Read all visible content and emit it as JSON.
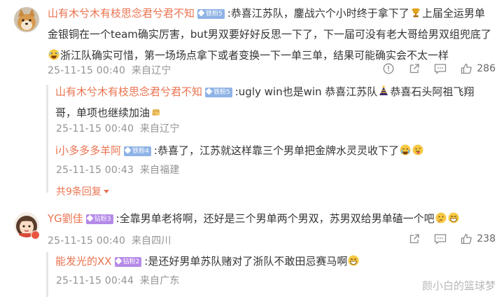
{
  "comment1": {
    "username": "山有木兮木有枝思念君兮君不知",
    "badge": "铁粉5",
    "text_1": ":恭喜江苏队，鏖战六个小时终于拿下了",
    "text_2": "上届全运男单",
    "text_3": "金银铜在一个team确实厉害，but男双要好好反思一下了，下一届可没有老大哥给男双组兜底了",
    "text_4": "浙江队确实可惜，第一场场点拿下或者变换一下一单三单，结果可能确实会不太一样",
    "time": "25-11-15 00:40",
    "location": "来自辽宁",
    "likes": "286"
  },
  "reply1": {
    "username": "山有木兮木有枝思念君兮君不知",
    "badge": "铁粉5",
    "text_1": ":ugly win也是win 恭喜江苏队",
    "text_2": "恭喜石头阿祖飞翔",
    "text_3": "哥，单项也继续加油",
    "time": "25-11-15 00:40",
    "location": "来自辽宁"
  },
  "reply2": {
    "username": "i小多多多羊阿",
    "badge": "铁粉4",
    "text_1": ":恭喜了，江苏就这样靠三个男单把金牌水灵灵收下了",
    "time": "25-11-15 00:43",
    "location": "来自福建"
  },
  "more_replies": "共9条回复",
  "comment2": {
    "username": "YG劉佳",
    "badge": "钻粉3",
    "text_1": ":全靠男单老将啊，还好是三个男单两个男双，苏男双给男单磕一个吧",
    "time": "25-11-15 00:40",
    "location": "来自四川",
    "likes": "238"
  },
  "reply3": {
    "username": "能发光的XX",
    "badge": "钻粉2",
    "text_1": ":是还好男单苏队赌对了浙队不敢田忌赛马啊",
    "time": "25-11-15 00:44",
    "location": "来自广东"
  },
  "watermark": "颜小白的篮球梦",
  "colors": {
    "username": "#eb7350",
    "iron_badge": "#8fb3e6",
    "diamond_badge": "#b58ae8",
    "meta": "#939393"
  }
}
